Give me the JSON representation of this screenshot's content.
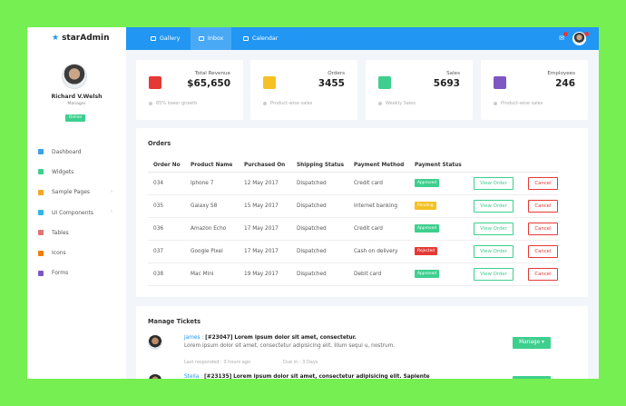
{
  "brand": {
    "name": "starAdmin"
  },
  "user": {
    "name": "Richard V.Welsh",
    "role": "Manager",
    "status": "Online"
  },
  "sidebar": {
    "items": [
      {
        "label": "Dashboard",
        "icon": "dashboard-icon",
        "color": "#3aa0e8",
        "has_children": false
      },
      {
        "label": "Widgets",
        "icon": "widgets-icon",
        "color": "#3ecf8e",
        "has_children": false
      },
      {
        "label": "Sample Pages",
        "icon": "pages-icon",
        "color": "#f5a623",
        "has_children": true
      },
      {
        "label": "UI Components",
        "icon": "components-icon",
        "color": "#30b6e8",
        "has_children": true
      },
      {
        "label": "Tables",
        "icon": "tables-icon",
        "color": "#e57373",
        "has_children": false
      },
      {
        "label": "Icons",
        "icon": "icons-icon",
        "color": "#f57c00",
        "has_children": false
      },
      {
        "label": "Forms",
        "icon": "forms-icon",
        "color": "#7e57c2",
        "has_children": false
      }
    ]
  },
  "topbar": {
    "tabs": [
      {
        "label": "Gallery",
        "active": false
      },
      {
        "label": "Inbox",
        "active": true
      },
      {
        "label": "Calendar",
        "active": false
      }
    ],
    "mail_badge": "4",
    "bell_badge": "4"
  },
  "stats": [
    {
      "label": "Total Revenue",
      "value": "$65,650",
      "foot": "65% lower growth",
      "icon": "cube-icon",
      "color": "#e53935"
    },
    {
      "label": "Orders",
      "value": "3455",
      "foot": "Product-wise sales",
      "icon": "receipt-icon",
      "color": "#f5c123"
    },
    {
      "label": "Sales",
      "value": "5693",
      "foot": "Weekly Sales",
      "icon": "bar-chart-icon",
      "color": "#3ecf8e"
    },
    {
      "label": "Employees",
      "value": "246",
      "foot": "Product-wise sales",
      "icon": "account-icon",
      "color": "#7e57c2"
    }
  ],
  "orders": {
    "title": "Orders",
    "columns": [
      "Order No",
      "Product Name",
      "Purchased On",
      "Shipping Status",
      "Payment Method",
      "Payment Status"
    ],
    "view_label": "View Order",
    "cancel_label": "Cancel",
    "rows": [
      {
        "no": "034",
        "product": "Iphone 7",
        "date": "12 May 2017",
        "shipping": "Dispatched",
        "method": "Credit card",
        "status": "Approved",
        "status_color": "#3ecf8e"
      },
      {
        "no": "035",
        "product": "Galaxy S8",
        "date": "15 May 2017",
        "shipping": "Dispatched",
        "method": "Internet banking",
        "status": "Pending",
        "status_color": "#f5c123"
      },
      {
        "no": "036",
        "product": "Amazon Echo",
        "date": "17 May 2017",
        "shipping": "Dispatched",
        "method": "Credit card",
        "status": "Approved",
        "status_color": "#3ecf8e"
      },
      {
        "no": "037",
        "product": "Google Pixel",
        "date": "17 May 2017",
        "shipping": "Dispatched",
        "method": "Cash on delivery",
        "status": "Rejected",
        "status_color": "#e53935"
      },
      {
        "no": "038",
        "product": "Mac Mini",
        "date": "19 May 2017",
        "shipping": "Dispatched",
        "method": "Debit card",
        "status": "Approved",
        "status_color": "#3ecf8e"
      }
    ]
  },
  "tickets": {
    "title": "Manage Tickets",
    "manage_label": "Manage",
    "items": [
      {
        "name": "James :",
        "ref": "[#23047]",
        "subject": "Lorem ipsum dolor sit amet, consectetur.",
        "body": "Lorem ipsum dolor sit amet, consectetur adipisicing elit. Illum sequi u, nostrum.",
        "last": "Last responded : 3 hours ago",
        "due": "Due in : 3 Days"
      },
      {
        "name": "Stella :",
        "ref": "[#23135]",
        "subject": "Lorem ipsum dolor sit amet, consectetur adipisicing elit. Sapiente",
        "body": "",
        "last": "",
        "due": ""
      }
    ]
  }
}
